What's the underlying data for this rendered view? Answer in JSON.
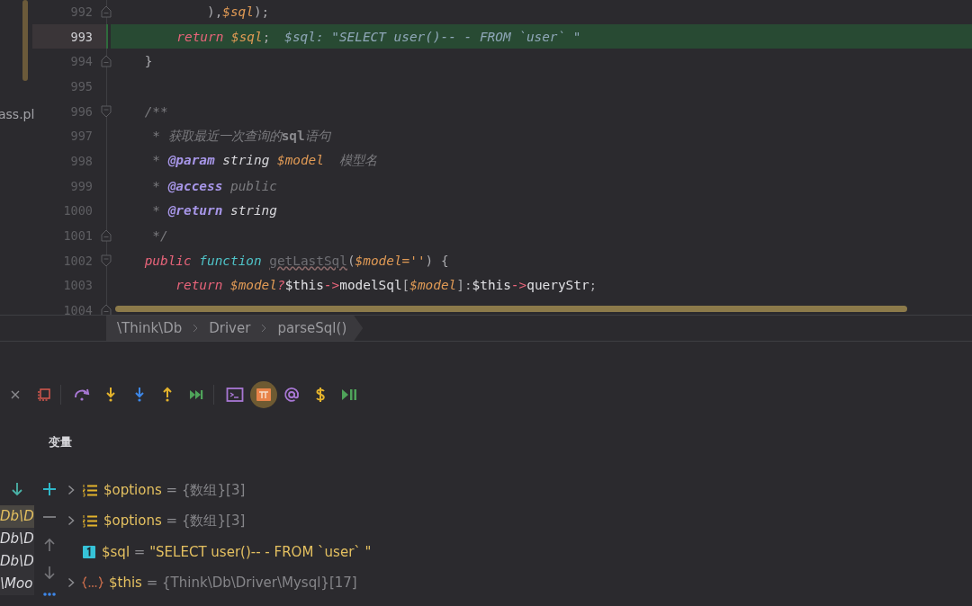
{
  "project": {
    "file_label": "ass.pl"
  },
  "code_lines": [
    {
      "number": "992",
      "current": false,
      "kind": "fold-end",
      "tokens": [
        {
          "text": "            ),",
          "kind": "plain"
        },
        {
          "text": "$sql",
          "kind": "var"
        },
        {
          "text": ");",
          "kind": "plain"
        }
      ]
    },
    {
      "number": "993",
      "current": true,
      "kind": "plain",
      "tokens": [
        {
          "text": "        return ",
          "kind": "keyword"
        },
        {
          "text": "$sql",
          "kind": "var"
        },
        {
          "text": ";",
          "kind": "plain"
        }
      ],
      "hint": "$sql: \"SELECT user()-- - FROM `user` \""
    },
    {
      "number": "994",
      "current": false,
      "kind": "fold-end",
      "tokens": [
        {
          "text": "    }",
          "kind": "plain"
        }
      ]
    },
    {
      "number": "995",
      "current": false,
      "kind": "plain"
    },
    {
      "number": "996",
      "current": false,
      "kind": "fold-start",
      "tokens": [
        {
          "text": "    /**",
          "kind": "comment"
        }
      ]
    },
    {
      "number": "997",
      "current": false,
      "kind": "plain",
      "tokens": [
        {
          "text": "     * 获取最近一次查询的",
          "kind": "comment"
        },
        {
          "text": "sql",
          "kind": "commentbold"
        },
        {
          "text": "语句",
          "kind": "comment"
        }
      ]
    },
    {
      "number": "998",
      "current": false,
      "kind": "plain",
      "tokens": [
        {
          "text": "     * ",
          "kind": "comment"
        },
        {
          "text": "@param ",
          "kind": "doctag"
        },
        {
          "text": "string ",
          "kind": "doctype"
        },
        {
          "text": "$model",
          "kind": "var"
        },
        {
          "text": "  模型名",
          "kind": "comment"
        }
      ]
    },
    {
      "number": "999",
      "current": false,
      "kind": "plain",
      "tokens": [
        {
          "text": "     * ",
          "kind": "comment"
        },
        {
          "text": "@access",
          "kind": "doctag"
        },
        {
          "text": " public",
          "kind": "comment"
        }
      ]
    },
    {
      "number": "1000",
      "current": false,
      "kind": "plain",
      "tokens": [
        {
          "text": "     * ",
          "kind": "comment"
        },
        {
          "text": "@return ",
          "kind": "doctag"
        },
        {
          "text": "string",
          "kind": "doctype"
        }
      ]
    },
    {
      "number": "1001",
      "current": false,
      "kind": "fold-end",
      "tokens": [
        {
          "text": "     */",
          "kind": "comment"
        }
      ]
    },
    {
      "number": "1002",
      "current": false,
      "kind": "fold-start",
      "tokens": [
        {
          "text": "    public ",
          "kind": "keyword"
        },
        {
          "text": "function ",
          "kind": "function"
        },
        {
          "text": "getLastSql",
          "kind": "unused"
        },
        {
          "text": "(",
          "kind": "plain"
        },
        {
          "text": "$model=''",
          "kind": "var"
        },
        {
          "text": ") {",
          "kind": "plain"
        }
      ]
    },
    {
      "number": "1003",
      "current": false,
      "kind": "plain",
      "tokens": [
        {
          "text": "        return ",
          "kind": "keyword"
        },
        {
          "text": "$model",
          "kind": "var"
        },
        {
          "text": "?",
          "kind": "keyword"
        },
        {
          "text": "$this",
          "kind": "bright"
        },
        {
          "text": "->",
          "kind": "keyword"
        },
        {
          "text": "modelSql",
          "kind": "bright"
        },
        {
          "text": "[",
          "kind": "plain"
        },
        {
          "text": "$model",
          "kind": "var"
        },
        {
          "text": "]:",
          "kind": "plain"
        },
        {
          "text": "$this",
          "kind": "bright"
        },
        {
          "text": "->",
          "kind": "keyword"
        },
        {
          "text": "queryStr",
          "kind": "bright"
        },
        {
          "text": ";",
          "kind": "plain"
        }
      ]
    },
    {
      "number": "1004",
      "current": false,
      "kind": "fold-end"
    }
  ],
  "breadcrumbs": [
    "\\Think\\Db",
    "Driver",
    "parseSql()"
  ],
  "toolbar": [
    {
      "kind": "close",
      "on": false
    },
    {
      "kind": "frames",
      "on": false
    },
    {
      "kind": "step-over",
      "on": false
    },
    {
      "kind": "step-into",
      "on": false
    },
    {
      "kind": "force-step-into",
      "on": false
    },
    {
      "kind": "step-out",
      "on": false
    },
    {
      "kind": "run-to-cursor",
      "on": false
    },
    {
      "kind": "evaluate",
      "on": false
    },
    {
      "kind": "pi",
      "on": true
    },
    {
      "kind": "at",
      "on": false
    },
    {
      "kind": "dollar",
      "on": false
    },
    {
      "kind": "resume",
      "on": false
    }
  ],
  "panel_title": "变量",
  "frames": [
    {
      "label": "Db\\D",
      "selected": true
    },
    {
      "label": "Db\\D",
      "selected": false
    },
    {
      "label": "Db\\D",
      "selected": false
    },
    {
      "label": "\\Moo",
      "selected": false
    }
  ],
  "variables": [
    {
      "kind": "array",
      "expandable": true,
      "name": "$options",
      "eq": "=",
      "value": "{数组}",
      "count": "[3]"
    },
    {
      "kind": "array",
      "expandable": true,
      "name": "$options",
      "eq": "=",
      "value": "{数组}",
      "count": "[3]"
    },
    {
      "kind": "scalar",
      "expandable": false,
      "name": "$sql",
      "eq": "=",
      "value": "\"SELECT user()-- - FROM `user` \""
    },
    {
      "kind": "object",
      "expandable": true,
      "name": "$this",
      "eq": "=",
      "value": "{Think\\Db\\Driver\\Mysql}",
      "count": "[17]"
    }
  ]
}
